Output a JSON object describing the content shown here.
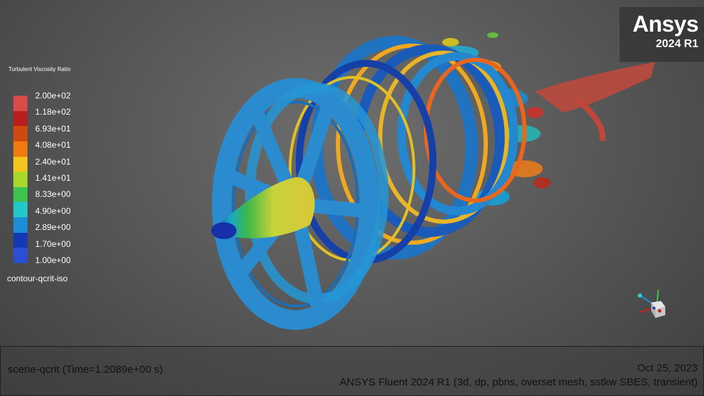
{
  "brand": {
    "name": "Ansys",
    "version": "2024 R1"
  },
  "legend": {
    "title": "Turbulent Viscosity Ratio",
    "labels": [
      "2.00e+02",
      "1.18e+02",
      "6.93e+01",
      "4.08e+01",
      "2.40e+01",
      "1.41e+01",
      "8.33e+00",
      "4.90e+00",
      "2.89e+00",
      "1.70e+00",
      "1.00e+00"
    ],
    "colors": [
      "#d94a4a",
      "#b81e1e",
      "#d04a10",
      "#f07a10",
      "#f3c61e",
      "#a8d82a",
      "#3ec44e",
      "#23c8c8",
      "#1a8fd8",
      "#1238b4",
      "#2a4fd6"
    ],
    "contour_name": "contour-qcrit-iso"
  },
  "info": {
    "scene": "scene-qcrit  (Time=1.2089e+00 s)",
    "date": "Oct 25, 2023",
    "solver": "ANSYS Fluent 2024 R1  (3d, dp, pbns, overset mesh, sstkw SBES, transient)"
  },
  "icons": {
    "triad": "axis-triad-icon"
  }
}
